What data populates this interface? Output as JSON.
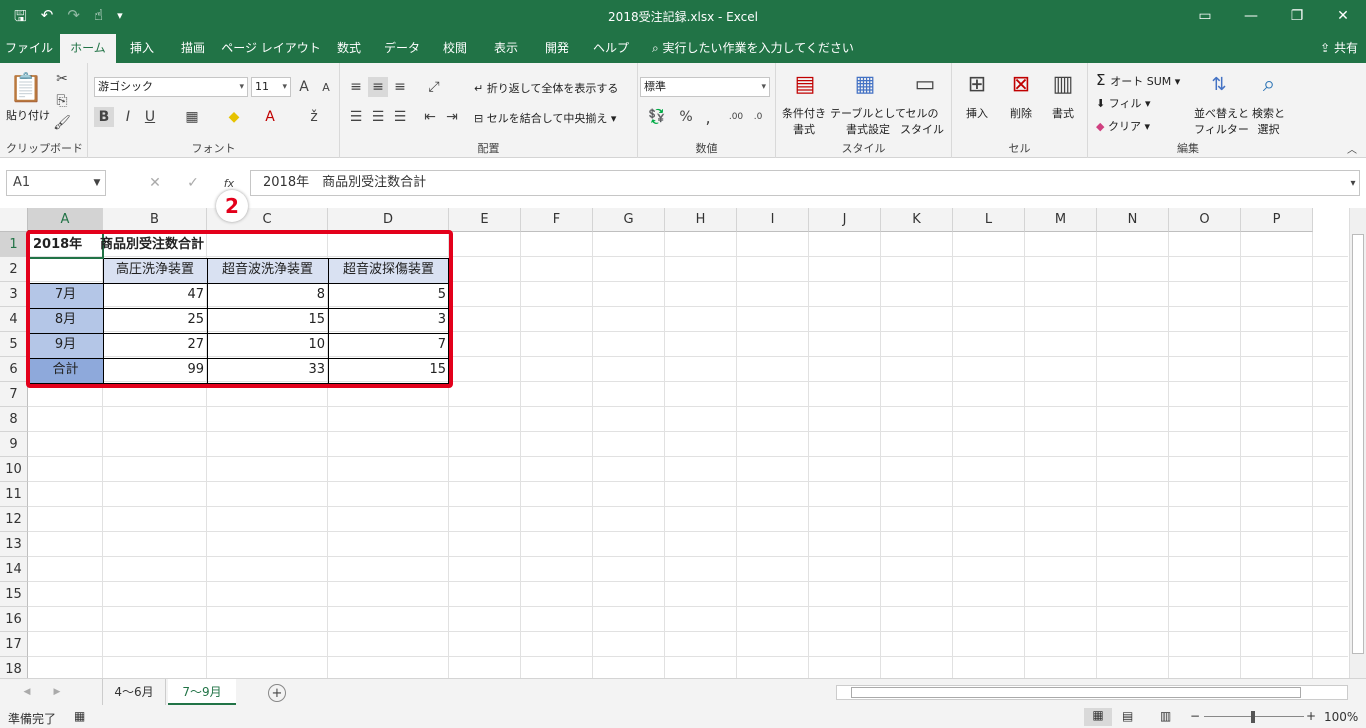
{
  "title": "2018受注記録.xlsx  -  Excel",
  "qat": [
    "save-icon",
    "undo-icon",
    "redo-icon",
    "touch-mode-icon",
    "customize-icon"
  ],
  "tabs": [
    "ファイル",
    "ホーム",
    "挿入",
    "描画",
    "ページ レイアウト",
    "数式",
    "データ",
    "校閲",
    "表示",
    "開発",
    "ヘルプ"
  ],
  "tellme": "実行したい作業を入力してください",
  "share": "共有",
  "ribbon": {
    "clipboard": {
      "paste": "貼り付け",
      "label": "クリップボード"
    },
    "font": {
      "name": "游ゴシック",
      "size": "11",
      "label": "フォント",
      "bold": "B",
      "italic": "I",
      "underline": "U"
    },
    "align": {
      "wrap": "折り返して全体を表示する",
      "merge": "セルを結合して中央揃え",
      "label": "配置"
    },
    "number": {
      "format": "標準",
      "label": "数値",
      "percent": "%"
    },
    "styles": {
      "cond": "条件付き",
      "cond2": "書式",
      "table": "テーブルとして",
      "table2": "書式設定",
      "cell": "セルの",
      "cell2": "スタイル",
      "label": "スタイル"
    },
    "cells": {
      "insert": "挿入",
      "delete": "削除",
      "format": "書式",
      "label": "セル"
    },
    "editing": {
      "autosum": "オート SUM",
      "fill": "フィル",
      "clear": "クリア",
      "sort": "並べ替えと",
      "sort2": "フィルター",
      "find": "検索と",
      "find2": "選択",
      "label": "編集"
    }
  },
  "namebox": "A1",
  "formula": "2018年　商品別受注数合計",
  "badge": "2",
  "columns": [
    "A",
    "B",
    "C",
    "D",
    "E",
    "F",
    "G",
    "H",
    "I",
    "J",
    "K",
    "L",
    "M",
    "N",
    "O",
    "P"
  ],
  "rows": [
    "1",
    "2",
    "3",
    "4",
    "5",
    "6",
    "7",
    "8",
    "9",
    "10",
    "11",
    "12",
    "13",
    "14",
    "15",
    "16",
    "17",
    "18"
  ],
  "cells": {
    "a1": "2018年",
    "b1": "商品別受注数合計",
    "b2": "高圧洗浄装置",
    "c2": "超音波洗浄装置",
    "d2": "超音波探傷装置",
    "a3": "7月",
    "b3": "47",
    "c3": "8",
    "d3": "5",
    "a4": "8月",
    "b4": "25",
    "c4": "15",
    "d4": "3",
    "a5": "9月",
    "b5": "27",
    "c5": "10",
    "d5": "7",
    "a6": "合計",
    "b6": "99",
    "c6": "33",
    "d6": "15"
  },
  "sheets": [
    "4～6月",
    "7～9月"
  ],
  "status": {
    "ready": "準備完了",
    "zoom": "100%"
  }
}
